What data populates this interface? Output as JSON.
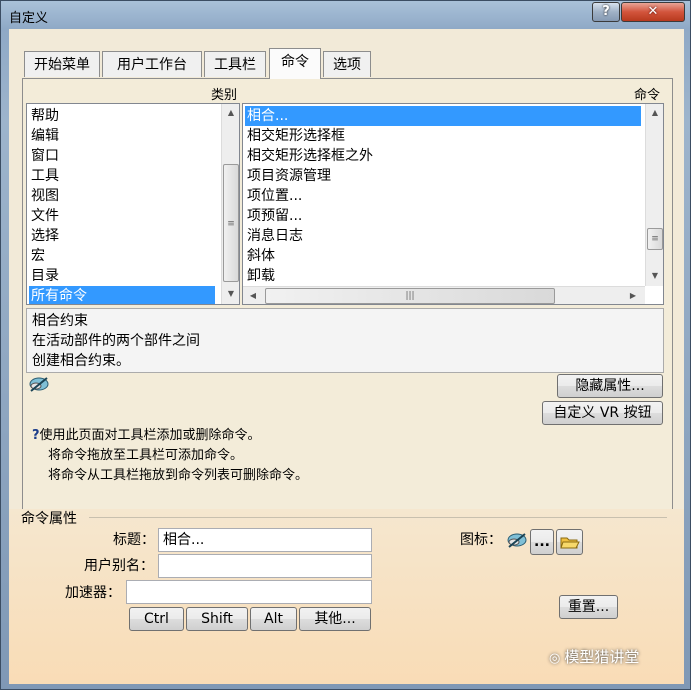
{
  "window": {
    "title": "自定义",
    "help_label": "?",
    "close_label": "✕"
  },
  "tabs": [
    {
      "label": "开始菜单"
    },
    {
      "label": "用户工作台"
    },
    {
      "label": "工具栏"
    },
    {
      "label": "命令"
    },
    {
      "label": "选项"
    }
  ],
  "active_tab": "命令",
  "categories": {
    "header": "类别",
    "items": [
      "帮助",
      "编辑",
      "窗口",
      "工具",
      "视图",
      "文件",
      "选择",
      "宏",
      "目录",
      "所有命令"
    ],
    "selected": "所有命令"
  },
  "commands": {
    "header": "命令",
    "items": [
      "相合...",
      "相交矩形选择框",
      "相交矩形选择框之外",
      "项目资源管理",
      "项位置...",
      "项预留...",
      "消息日志",
      "斜体",
      "卸载"
    ],
    "selected": "相合..."
  },
  "description": {
    "lines": [
      "相合约束",
      "在活动部件的两个部件之间",
      "创建相合约束。"
    ]
  },
  "buttons": {
    "hide_properties": "隐藏属性...",
    "customize_vr": "自定义 VR 按钮",
    "reset": "重置...",
    "more_icon": "..."
  },
  "hint": {
    "lines": [
      "使用此页面对工具栏添加或删除命令。",
      "将命令拖放至工具栏可添加命令。",
      "将命令从工具栏拖放到命令列表可删除命令。"
    ]
  },
  "properties": {
    "section_title": "命令属性",
    "title_label": "标题：",
    "title_value": "相合...",
    "alias_label": "用户别名：",
    "alias_value": "",
    "accelerator_label": "加速器：",
    "accelerator_value": "",
    "icon_label": "图标：",
    "modifiers": [
      "Ctrl",
      "Shift",
      "Alt",
      "其他..."
    ]
  },
  "watermark": "模型猎讲堂",
  "colors": {
    "selection": "#3399ff",
    "panel": "#f3ecd9",
    "close": "#d2543c"
  }
}
